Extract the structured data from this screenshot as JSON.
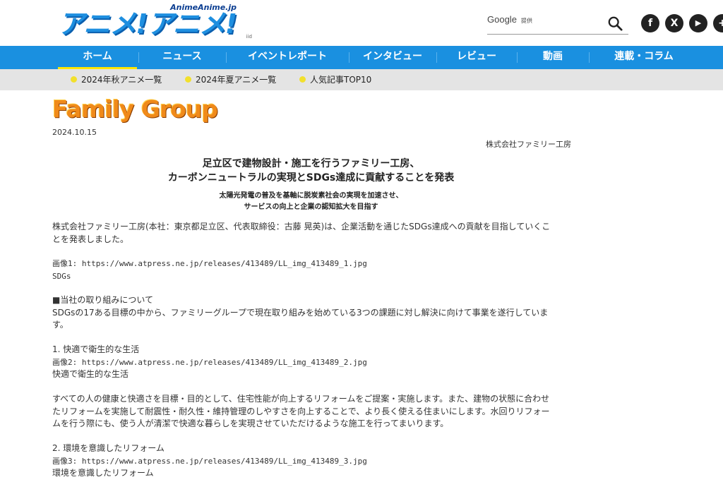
{
  "site": {
    "logo_small": "AnimeAnime.jp",
    "logo_main": "アニメ!アニメ!",
    "logo_tag": "iid"
  },
  "search": {
    "brand": "Google",
    "brand_sub": "提供",
    "placeholder": ""
  },
  "social": [
    "f",
    "X",
    "▶",
    "+"
  ],
  "nav": {
    "items": [
      "ホーム",
      "ニュース",
      "イベントレポート",
      "インタビュー",
      "レビュー",
      "動画",
      "連載・コラム"
    ],
    "active": "ホーム"
  },
  "subnav": {
    "items": [
      "2024年秋アニメ一覧",
      "2024年夏アニメ一覧",
      "人気記事TOP10"
    ]
  },
  "article": {
    "company_logo": "Family Group",
    "date": "2024.10.15",
    "issuer": "株式会社ファミリー工房",
    "title_line1": "足立区で建物設計・施工を行うファミリー工房、",
    "title_line2": "カーボンニュートラルの実現とSDGs達成に貢献することを発表",
    "subtitle_line1": "太陽光発電の普及を基軸に脱炭素社会の実現を加速させ、",
    "subtitle_line2": "サービスの向上と企業の認知拡大を目指す",
    "p1_line1": "株式会社ファミリー工房(本社：東京都足立区、代表取締役：古藤 晃英)は、企業活動を通じたSDGs達成への貢献を目指していくこ",
    "p1_line2": "とを発表しました。",
    "img1": "画像1: https://www.atpress.ne.jp/releases/413489/LL_img_413489_1.jpg",
    "img1_caption": "SDGs",
    "section_heading": "■当社の取り組みについて",
    "p2_line1": "SDGsの17ある目標の中から、ファミリーグループで現在取り組みを始めている3つの課題に対し解決に向けて事業を遂行していま",
    "p2_line2": "す。",
    "item1_heading": "1. 快適で衛生的な生活",
    "img2": "画像2: https://www.atpress.ne.jp/releases/413489/LL_img_413489_2.jpg",
    "img2_caption": "快適で衛生的な生活",
    "p3_line1": "すべての人の健康と快適さを目標・目的として、住宅性能が向上するリフォームをご提案・実施します。また、建物の状態に合わせ",
    "p3_line2": "たリフォームを実施して耐震性・耐久性・維持管理のしやすさを向上することで、より長く使える住まいにします。水回りリフォー",
    "p3_line3": "ムを行う際にも、使う人が清潔で快適な暮らしを実現させていただけるような施工を行ってまいります。",
    "item2_heading": "2. 環境を意識したリフォーム",
    "img3": "画像3: https://www.atpress.ne.jp/releases/413489/LL_img_413489_3.jpg",
    "img3_caption": "環境を意識したリフォーム"
  }
}
